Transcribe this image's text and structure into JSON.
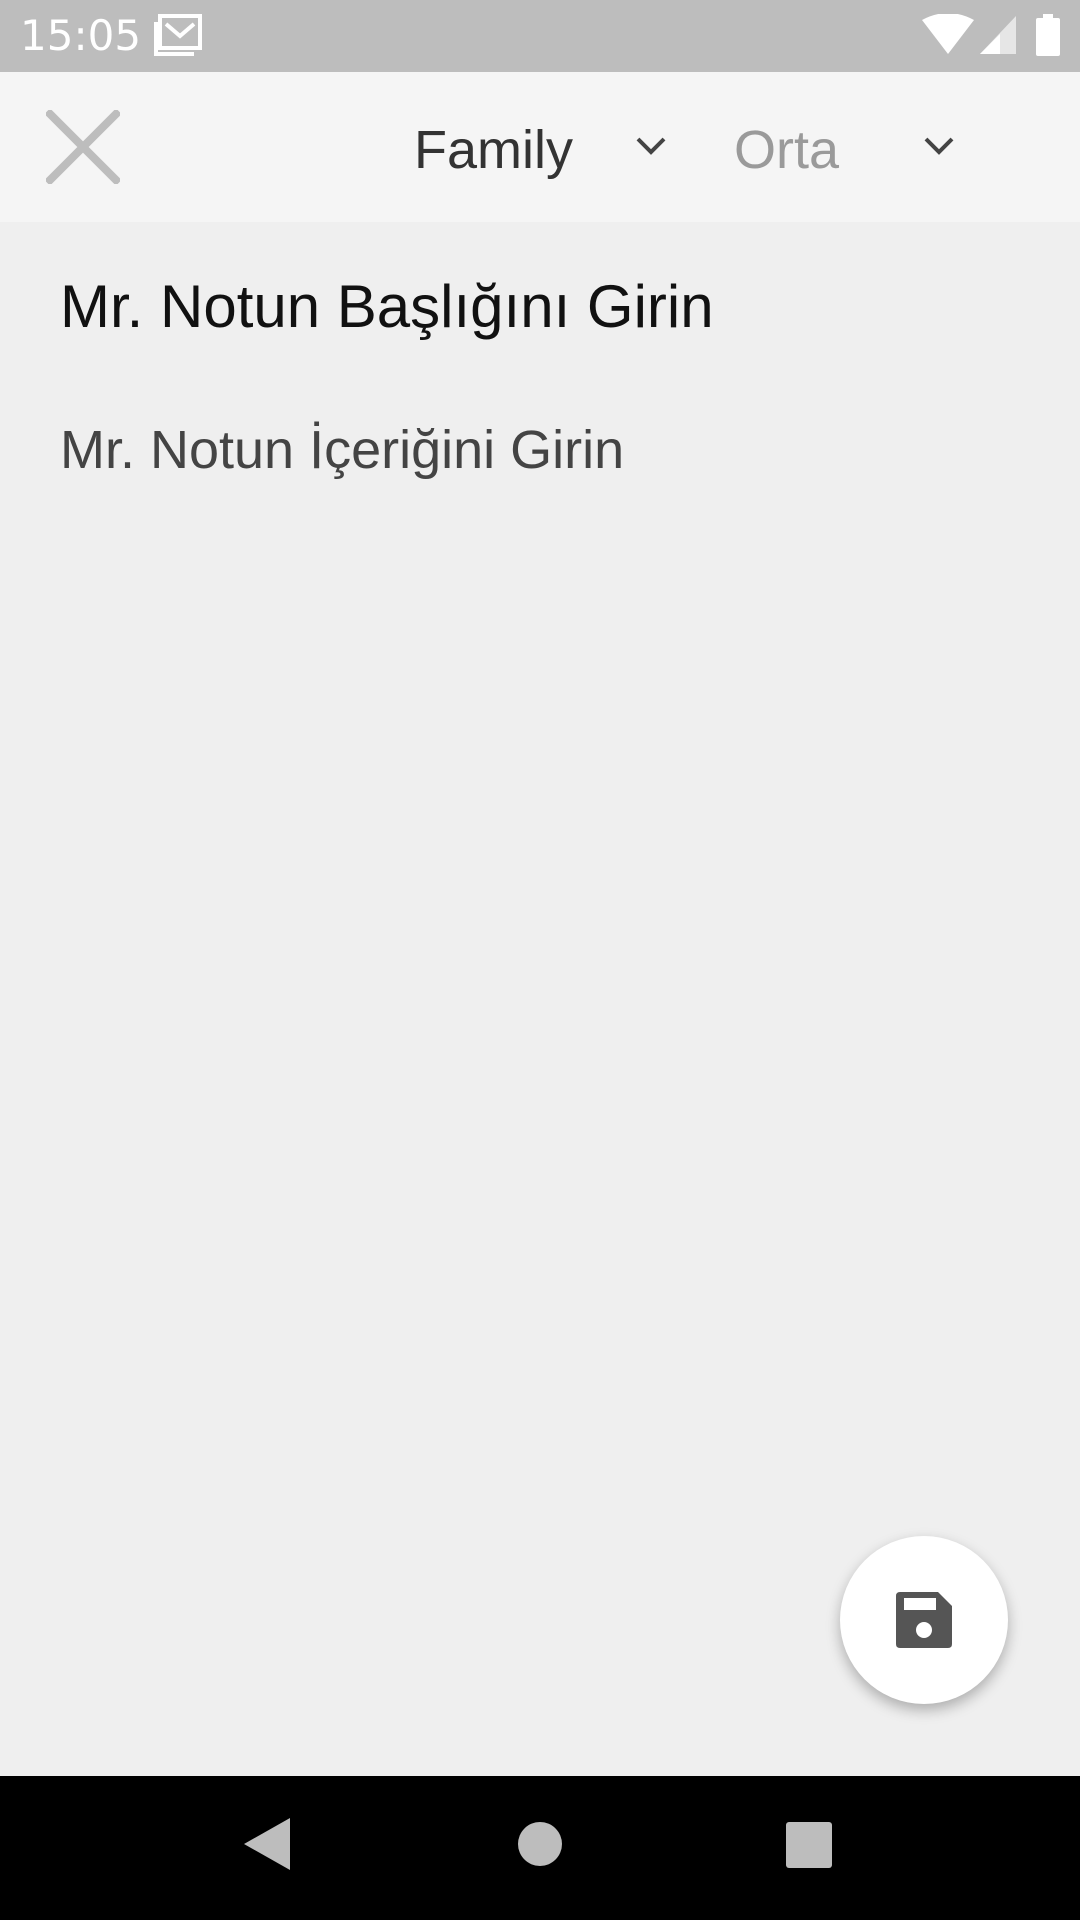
{
  "status_bar": {
    "time": "15:05",
    "icons": [
      "gmail-icon",
      "wifi-icon",
      "signal-icon",
      "battery-icon"
    ]
  },
  "toolbar": {
    "close_icon": "close-icon",
    "font_dropdown": {
      "selected": "Family"
    },
    "size_dropdown": {
      "selected": "Orta"
    }
  },
  "note": {
    "title_placeholder": "Mr. Notun Başlığını Girin",
    "content_placeholder": "Mr. Notun İçeriğini Girin"
  },
  "fab": {
    "icon": "save-icon",
    "background": "#ffffff",
    "icon_color": "#555555"
  },
  "nav_bar": {
    "icons": [
      "back-icon",
      "home-icon",
      "recents-icon"
    ]
  },
  "colors": {
    "status_bar": "#bdbdbd",
    "toolbar": "#f5f5f5",
    "background": "#efefef",
    "nav_bar": "#000000"
  }
}
